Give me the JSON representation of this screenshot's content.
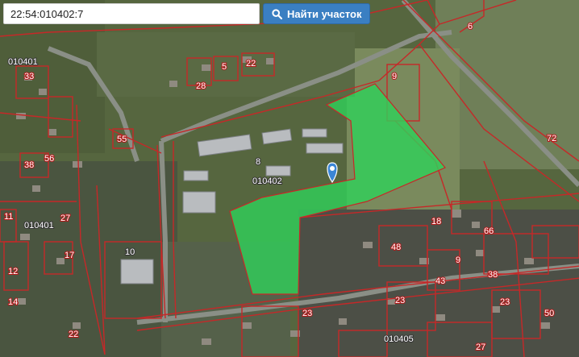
{
  "search": {
    "value": "22:54:010402:7",
    "button_label": "Найти участок"
  },
  "map": {
    "colors": {
      "boundary": "#c62828",
      "parcel_fill": "#2fd15a",
      "marker": "#3b86d6"
    },
    "parcel_label": "010402",
    "block_labels": [
      "010401",
      "010401",
      "010405",
      "8",
      "10"
    ],
    "lot_numbers": [
      "33",
      "28",
      "22",
      "5",
      "9",
      "6",
      "72",
      "55",
      "56",
      "38",
      "11",
      "12",
      "27",
      "17",
      "14",
      "22",
      "18",
      "48",
      "9",
      "38",
      "43",
      "23",
      "23",
      "50",
      "27",
      "23",
      "66"
    ]
  }
}
